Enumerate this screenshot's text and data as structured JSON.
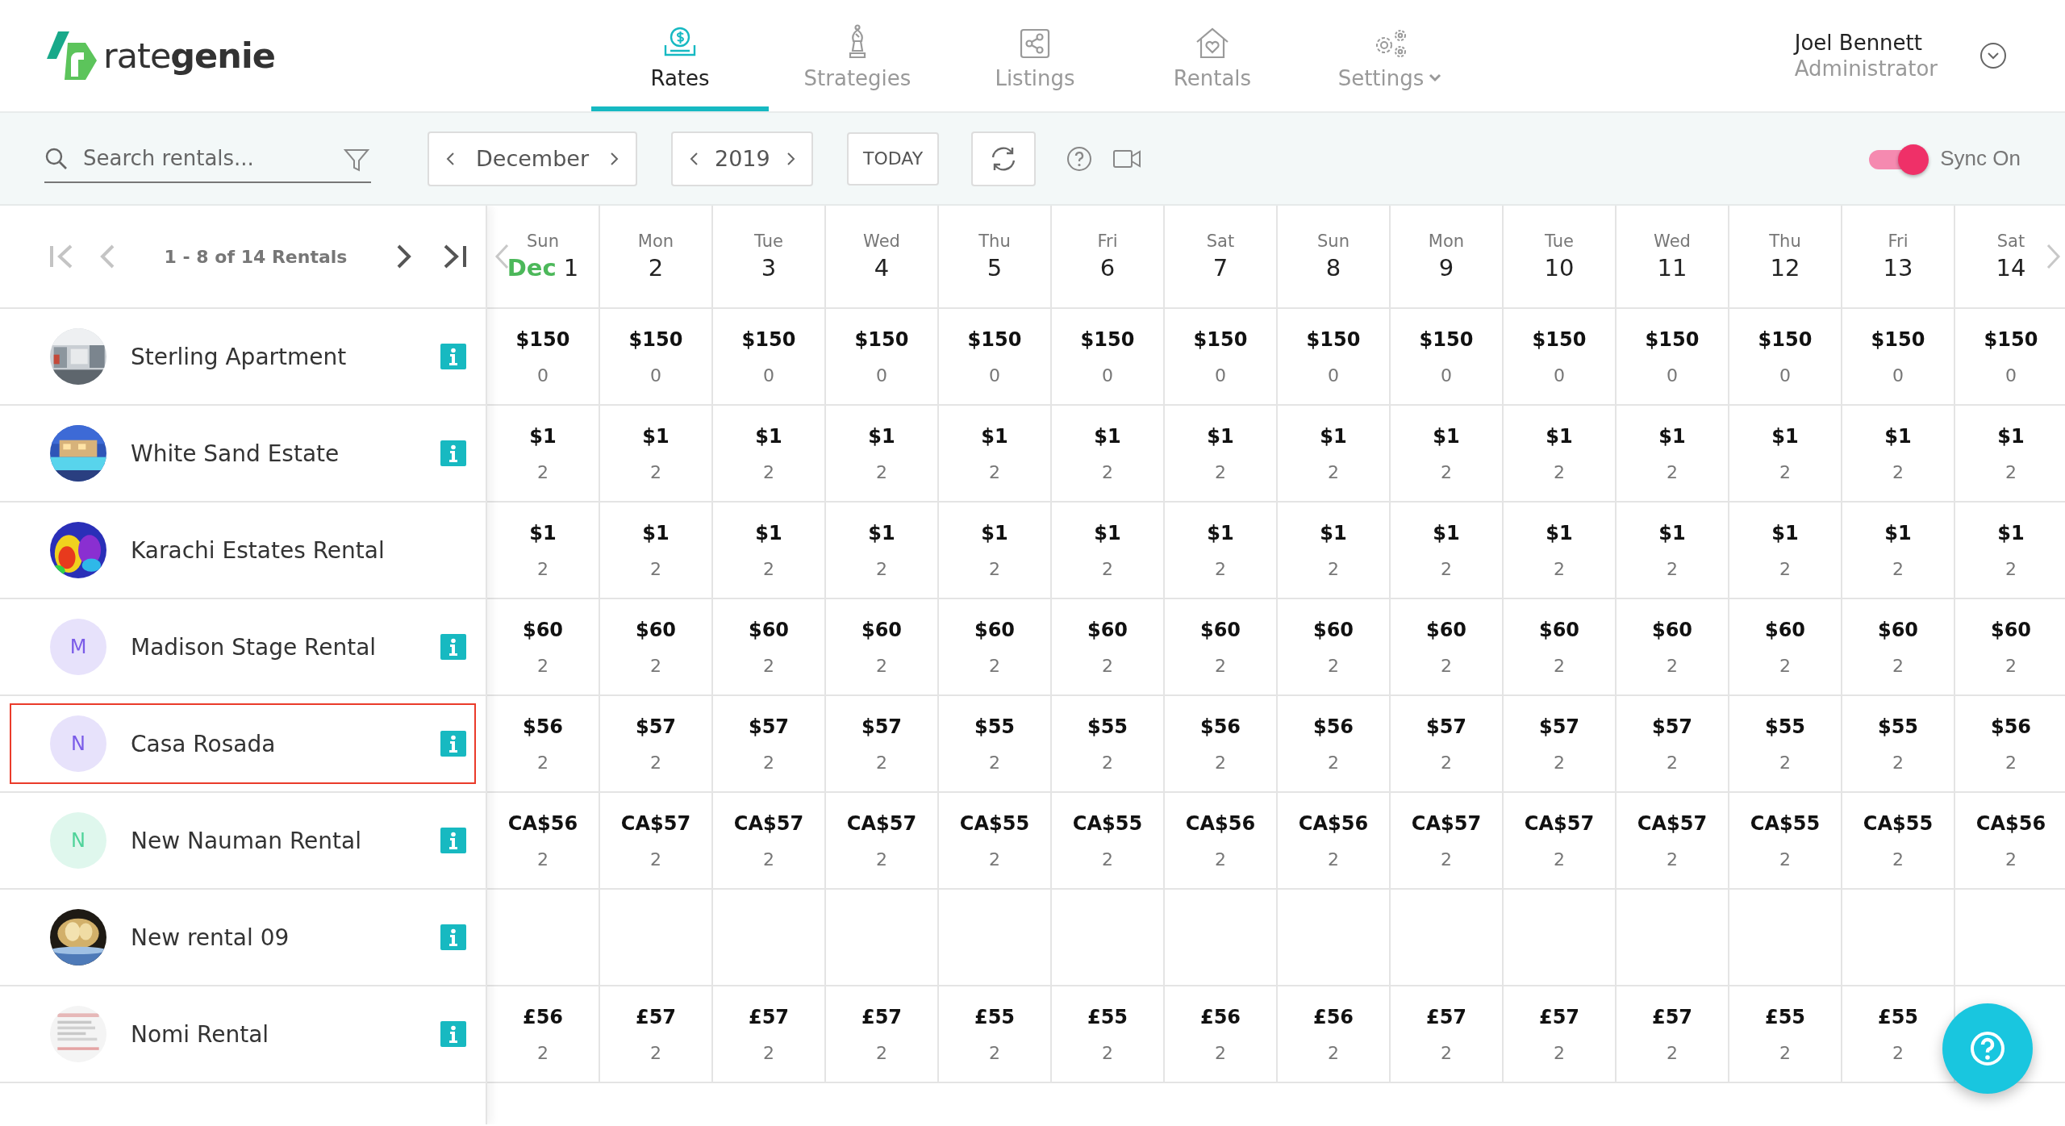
{
  "logo": {
    "light": "rate",
    "bold": "genie"
  },
  "nav": [
    {
      "kind": "rates",
      "label": "Rates",
      "selected": true
    },
    {
      "kind": "strategies",
      "label": "Strategies",
      "selected": false
    },
    {
      "kind": "listings",
      "label": "Listings",
      "selected": false
    },
    {
      "kind": "rentals",
      "label": "Rentals",
      "selected": false
    },
    {
      "kind": "settings",
      "label": "Settings",
      "selected": false,
      "has_menu": true
    }
  ],
  "user": {
    "name": "Joel Bennett",
    "role": "Administrator"
  },
  "toolbar": {
    "search": {
      "placeholder": "Search rentals..."
    },
    "month": "December",
    "year": "2019",
    "today": "TODAY",
    "sync": {
      "label": "Sync On",
      "on": true
    }
  },
  "pager": {
    "label": "1 - 8 of 14 Rentals",
    "first": {
      "disabled": true
    },
    "prev": {
      "disabled": true
    },
    "next": {
      "disabled": false
    },
    "last": {
      "disabled": false
    }
  },
  "days": [
    {
      "weekday": "Sun",
      "month": "Dec",
      "day": "1"
    },
    {
      "weekday": "Mon",
      "day": "2"
    },
    {
      "weekday": "Tue",
      "day": "3"
    },
    {
      "weekday": "Wed",
      "day": "4"
    },
    {
      "weekday": "Thu",
      "day": "5"
    },
    {
      "weekday": "Fri",
      "day": "6"
    },
    {
      "weekday": "Sat",
      "day": "7"
    },
    {
      "weekday": "Sun",
      "day": "8"
    },
    {
      "weekday": "Mon",
      "day": "9"
    },
    {
      "weekday": "Tue",
      "day": "10"
    },
    {
      "weekday": "Wed",
      "day": "11"
    },
    {
      "weekday": "Thu",
      "day": "12"
    },
    {
      "weekday": "Fri",
      "day": "13"
    },
    {
      "weekday": "Sat",
      "day": "14"
    }
  ],
  "rentals": [
    {
      "name": "Sterling Apartment",
      "avatar": {
        "kind": "picture"
      },
      "info": true,
      "selected": false,
      "prices": [
        "$150",
        "$150",
        "$150",
        "$150",
        "$150",
        "$150",
        "$150",
        "$150",
        "$150",
        "$150",
        "$150",
        "$150",
        "$150",
        "$150"
      ],
      "counts": [
        "0",
        "0",
        "0",
        "0",
        "0",
        "0",
        "0",
        "0",
        "0",
        "0",
        "0",
        "0",
        "0",
        "0"
      ]
    },
    {
      "name": "White Sand Estate",
      "avatar": {
        "kind": "picture"
      },
      "info": true,
      "selected": false,
      "prices": [
        "$1",
        "$1",
        "$1",
        "$1",
        "$1",
        "$1",
        "$1",
        "$1",
        "$1",
        "$1",
        "$1",
        "$1",
        "$1",
        "$1"
      ],
      "counts": [
        "2",
        "2",
        "2",
        "2",
        "2",
        "2",
        "2",
        "2",
        "2",
        "2",
        "2",
        "2",
        "2",
        "2"
      ]
    },
    {
      "name": "Karachi Estates Rental",
      "avatar": {
        "kind": "picture"
      },
      "info": false,
      "selected": false,
      "prices": [
        "$1",
        "$1",
        "$1",
        "$1",
        "$1",
        "$1",
        "$1",
        "$1",
        "$1",
        "$1",
        "$1",
        "$1",
        "$1",
        "$1"
      ],
      "counts": [
        "2",
        "2",
        "2",
        "2",
        "2",
        "2",
        "2",
        "2",
        "2",
        "2",
        "2",
        "2",
        "2",
        "2"
      ]
    },
    {
      "name": "Madison Stage Rental",
      "avatar": {
        "kind": "initial",
        "letter": "M",
        "color": "#7b5ce8"
      },
      "info": true,
      "selected": false,
      "prices": [
        "$60",
        "$60",
        "$60",
        "$60",
        "$60",
        "$60",
        "$60",
        "$60",
        "$60",
        "$60",
        "$60",
        "$60",
        "$60",
        "$60"
      ],
      "counts": [
        "2",
        "2",
        "2",
        "2",
        "2",
        "2",
        "2",
        "2",
        "2",
        "2",
        "2",
        "2",
        "2",
        "2"
      ]
    },
    {
      "name": "Casa Rosada",
      "avatar": {
        "kind": "initial",
        "letter": "N",
        "color": "#7b5ce8"
      },
      "info": true,
      "selected": true,
      "prices": [
        "$56",
        "$57",
        "$57",
        "$57",
        "$55",
        "$55",
        "$56",
        "$56",
        "$57",
        "$57",
        "$57",
        "$55",
        "$55",
        "$56"
      ],
      "counts": [
        "2",
        "2",
        "2",
        "2",
        "2",
        "2",
        "2",
        "2",
        "2",
        "2",
        "2",
        "2",
        "2",
        "2"
      ]
    },
    {
      "name": "New Nauman Rental",
      "avatar": {
        "kind": "initial",
        "letter": "N",
        "color": "#4fd39a"
      },
      "info": true,
      "selected": false,
      "prices": [
        "CA$56",
        "CA$57",
        "CA$57",
        "CA$57",
        "CA$55",
        "CA$55",
        "CA$56",
        "CA$56",
        "CA$57",
        "CA$57",
        "CA$57",
        "CA$55",
        "CA$55",
        "CA$56"
      ],
      "counts": [
        "2",
        "2",
        "2",
        "2",
        "2",
        "2",
        "2",
        "2",
        "2",
        "2",
        "2",
        "2",
        "2",
        "2"
      ]
    },
    {
      "name": "New rental 09",
      "avatar": {
        "kind": "picture"
      },
      "info": true,
      "selected": false
    },
    {
      "name": "Nomi Rental",
      "avatar": {
        "kind": "picture"
      },
      "info": true,
      "selected": false,
      "prices": [
        "£56",
        "£57",
        "£57",
        "£57",
        "£55",
        "£55",
        "£56",
        "£56",
        "£57",
        "£57",
        "£57",
        "£55",
        "£55"
      ],
      "counts": [
        "2",
        "2",
        "2",
        "2",
        "2",
        "2",
        "2",
        "2",
        "2",
        "2",
        "2",
        "2",
        "2"
      ]
    }
  ]
}
